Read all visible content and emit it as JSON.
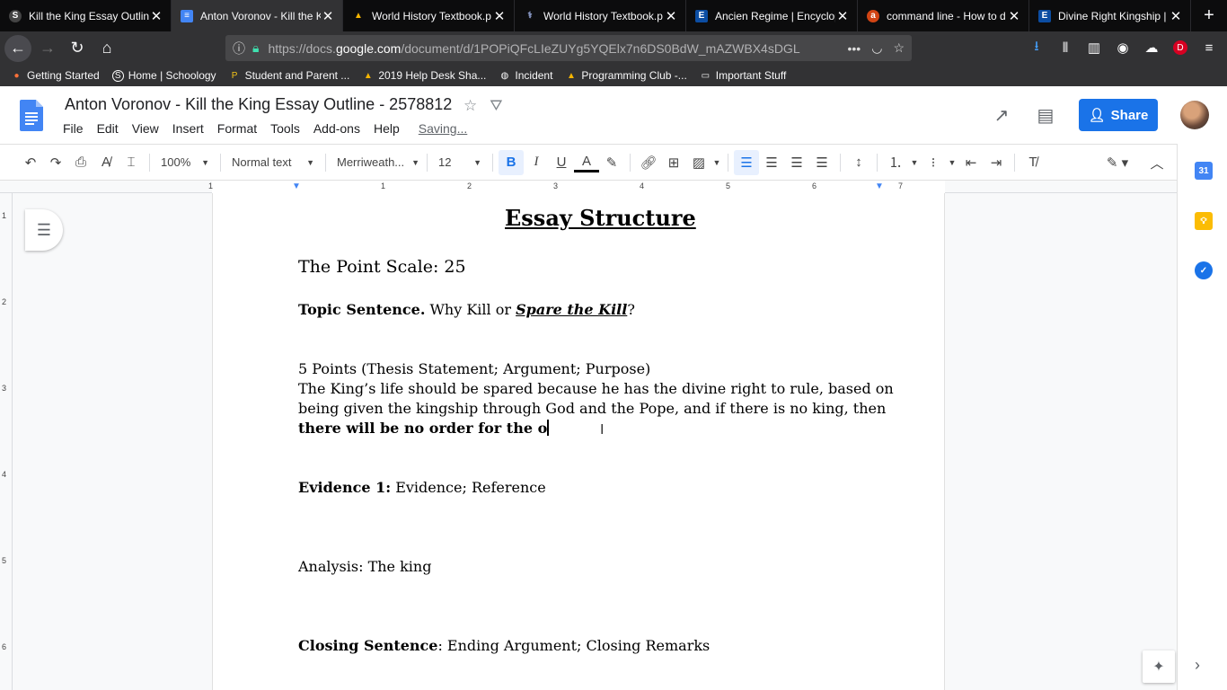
{
  "browser": {
    "tabs": [
      {
        "icon": "S",
        "icon_bg": "#444",
        "title": "Kill the King Essay Outlin",
        "active": false
      },
      {
        "icon": "≡",
        "icon_bg": "#4285f4",
        "title": "Anton Voronov - Kill the K",
        "active": true
      },
      {
        "icon": "▲",
        "icon_bg": "transparent",
        "title": "World History Textbook.p",
        "active": false
      },
      {
        "icon": "⚕",
        "icon_bg": "transparent",
        "title": "World History Textbook.p",
        "active": false
      },
      {
        "icon": "E",
        "icon_bg": "#0c4da2",
        "title": "Ancien Regime | Encyclop",
        "active": false
      },
      {
        "icon": "a",
        "icon_bg": "#d14414",
        "title": "command line - How to d",
        "active": false
      },
      {
        "icon": "E",
        "icon_bg": "#0c4da2",
        "title": "Divine Right Kingship | E",
        "active": false
      }
    ],
    "url_prefix": "https://docs.",
    "url_domain": "google.com",
    "url_rest": "/document/d/1POPiQFcLIeZUYg5YQElx7n6DS0BdW_mAZWBX4sDGL",
    "bookmarks": [
      {
        "icon": "firefox-icon",
        "glyph": "●",
        "color": "#ff7139",
        "label": "Getting Started"
      },
      {
        "icon": "schoology-icon",
        "glyph": "S",
        "color": "#fff",
        "label": "Home | Schoology"
      },
      {
        "icon": "parent-portal-icon",
        "glyph": "P",
        "color": "#f5c518",
        "label": "Student and Parent ..."
      },
      {
        "icon": "drive-icon",
        "glyph": "▲",
        "color": "#f4b400",
        "label": "2019 Help Desk Sha..."
      },
      {
        "icon": "globe-icon",
        "glyph": "◍",
        "color": "#ccc",
        "label": "Incident"
      },
      {
        "icon": "drive-icon",
        "glyph": "▲",
        "color": "#f4b400",
        "label": "Programming Club -..."
      },
      {
        "icon": "folder-icon",
        "glyph": "▭",
        "color": "#ccc",
        "label": "Important Stuff"
      }
    ]
  },
  "docs": {
    "title": "Anton Voronov - Kill the King Essay Outline - 2578812",
    "menu": [
      "File",
      "Edit",
      "View",
      "Insert",
      "Format",
      "Tools",
      "Add-ons",
      "Help"
    ],
    "saving": "Saving...",
    "share_label": "Share",
    "toolbar": {
      "zoom": "100%",
      "style": "Normal text",
      "font": "Merriweath...",
      "size": "12"
    },
    "ruler_h": [
      "1",
      "1",
      "2",
      "3",
      "4",
      "5",
      "6",
      "7"
    ],
    "ruler_v": [
      "1",
      "2",
      "3",
      "4",
      "5",
      "6"
    ]
  },
  "document": {
    "heading": "Essay Structure",
    "point_scale": "The Point Scale: 25",
    "topic_label": "Topic Sentence.",
    "topic_text": " Why Kill or ",
    "topic_emph": "Spare the Kill",
    "topic_end": "?",
    "points_label": "5 Points (Thesis Statement; Argument; Purpose)",
    "thesis_line1": "The King’s life should be spared because  he has the divine right to rule, based on",
    "thesis_line2": "being given the kingship through God and the Pope, and if there is no king, then",
    "thesis_line3": "there will be no order for the o",
    "evidence_label": "Evidence 1:",
    "evidence_text": " Evidence; Reference",
    "analysis": "Analysis: The king",
    "closing_label": "Closing Sentence",
    "closing_text": ": Ending Argument; Closing Remarks"
  },
  "colors": {
    "accent": "#1a73e8",
    "tab_strip": "#0c0c0d",
    "nav_bar": "#323234"
  }
}
